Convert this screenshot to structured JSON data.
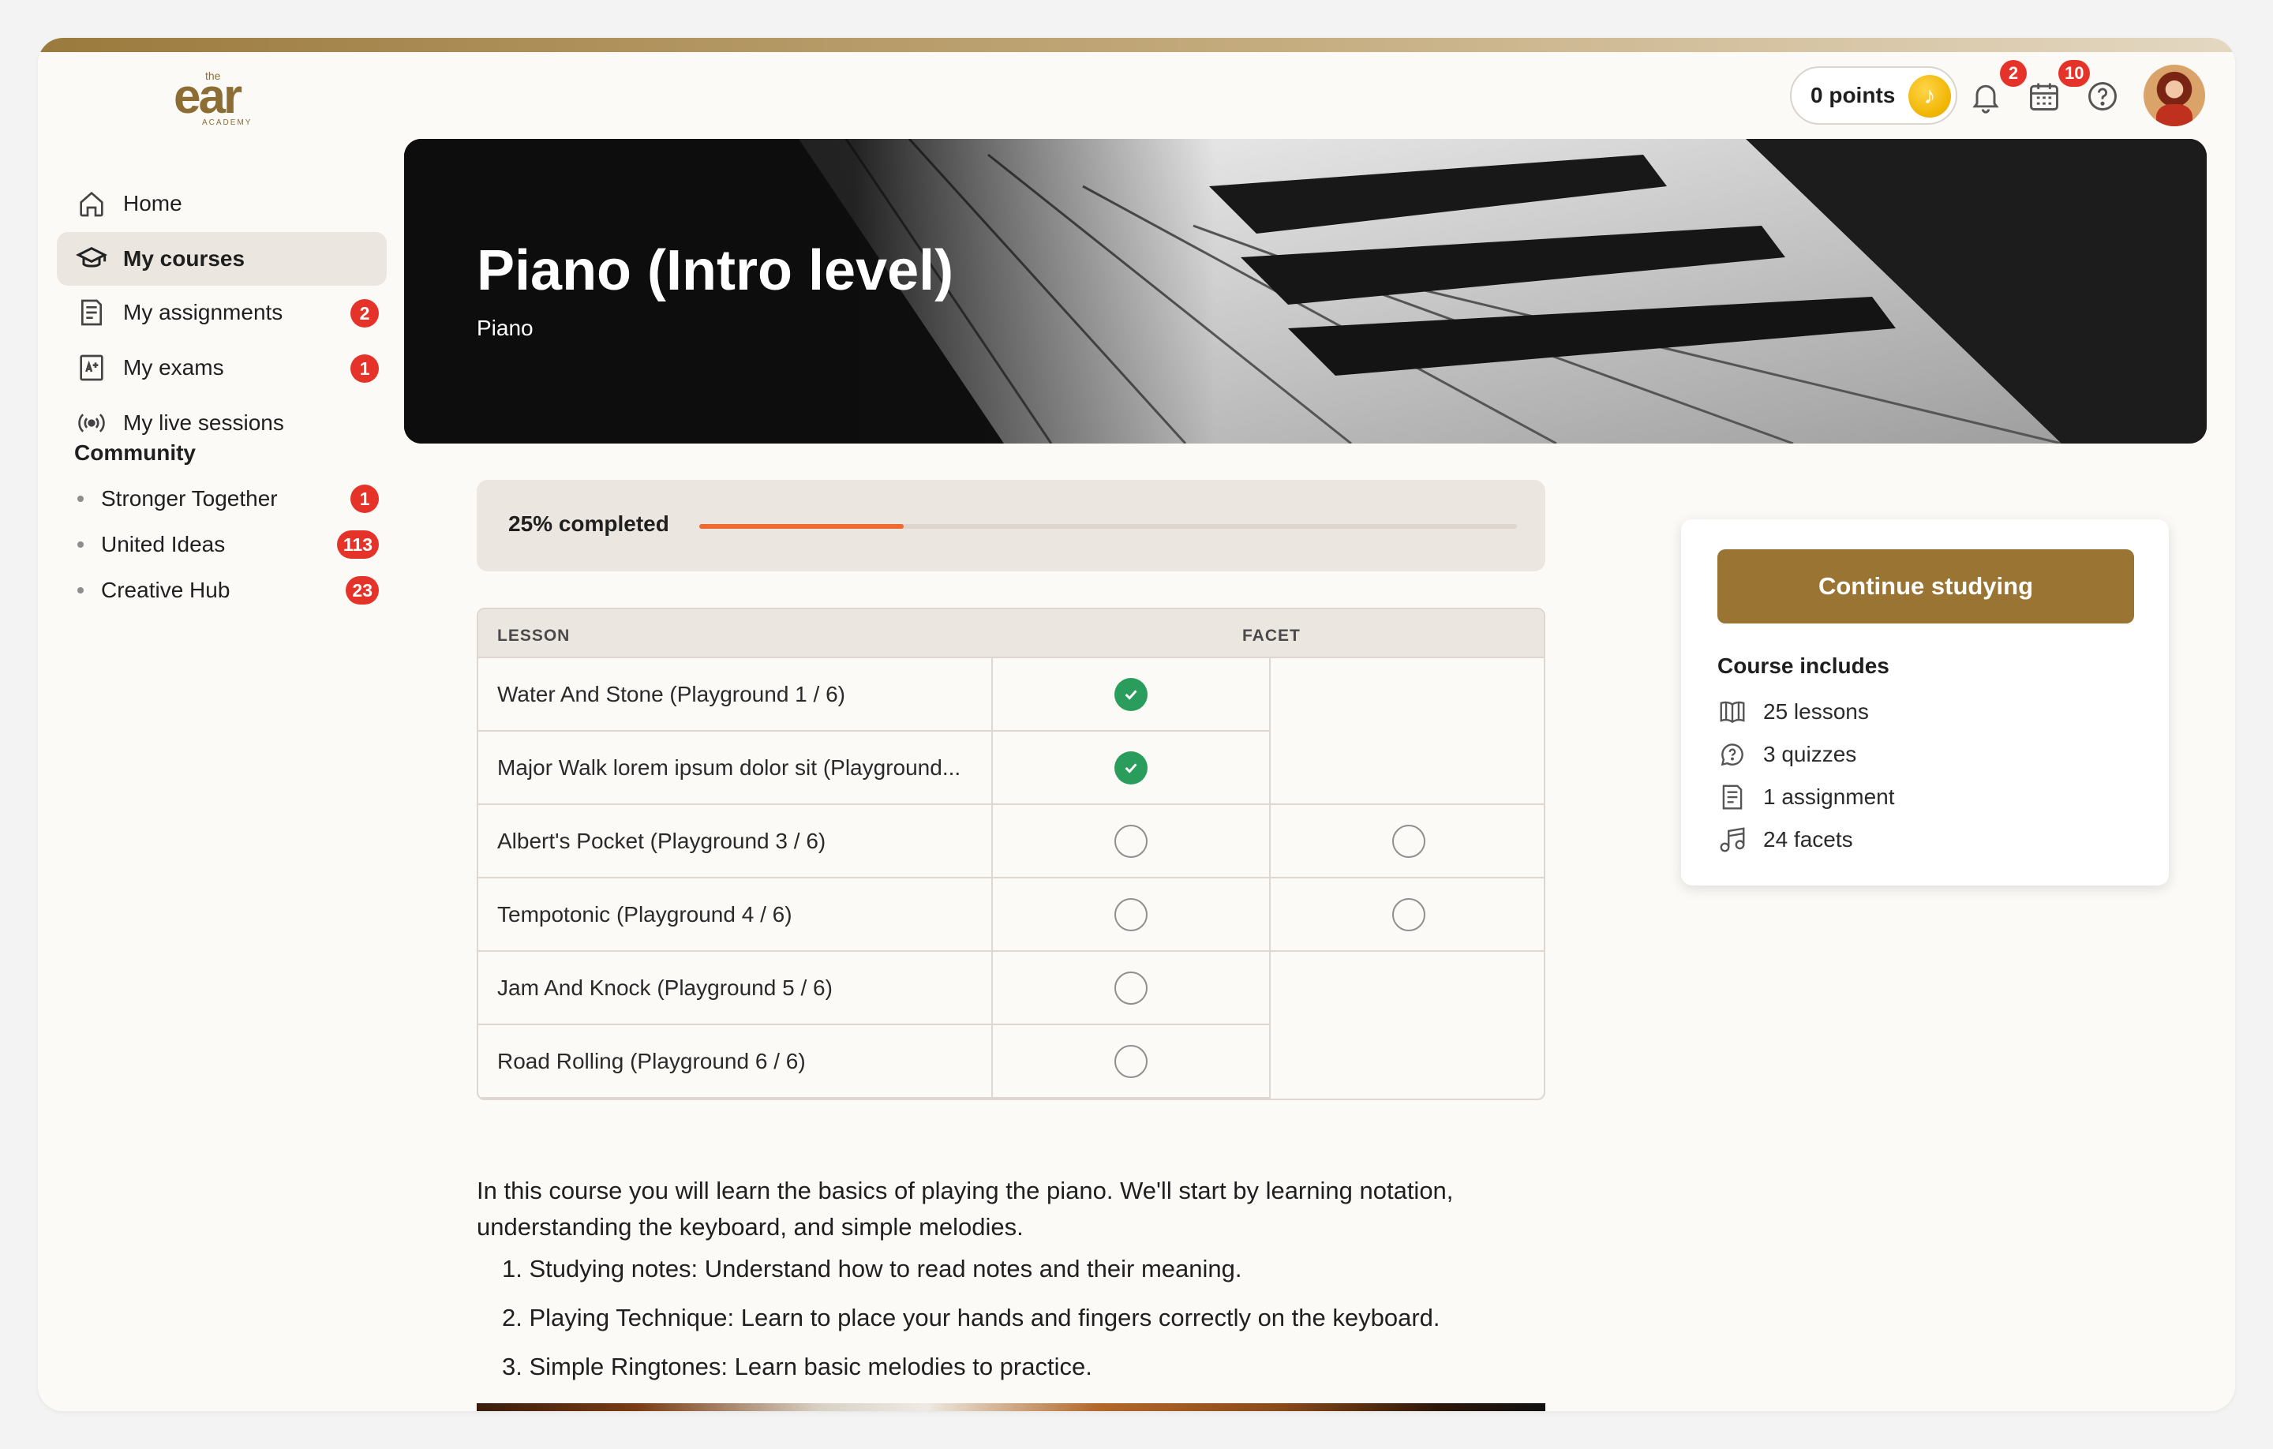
{
  "brand": {
    "logo_top": "the",
    "logo_main": "ear",
    "logo_sub": "ACADEMY"
  },
  "header": {
    "points_label": "0 points",
    "notifications_count": "2",
    "calendar_count": "10"
  },
  "sidebar": {
    "items": [
      {
        "label": "Home",
        "icon": "home-icon"
      },
      {
        "label": "My courses",
        "icon": "graduation-cap-icon",
        "active": true
      },
      {
        "label": "My assignments",
        "icon": "assignment-icon",
        "badge": "2"
      },
      {
        "label": "My exams",
        "icon": "exam-icon",
        "badge": "1"
      },
      {
        "label": "My live sessions",
        "icon": "broadcast-icon"
      }
    ],
    "community_title": "Community",
    "community": [
      {
        "label": "Stronger Together",
        "badge": "1"
      },
      {
        "label": "United Ideas",
        "badge": "113"
      },
      {
        "label": "Creative Hub",
        "badge": "23"
      }
    ]
  },
  "course": {
    "title": "Piano (Intro level)",
    "subtitle": "Piano",
    "progress_label": "25% completed",
    "progress_fraction": 0.25
  },
  "table": {
    "headers": [
      "LESSON",
      "FACET"
    ],
    "rows": [
      {
        "lesson": "Water And Stone (Playground 1 / 6)",
        "done": true
      },
      {
        "lesson": "Major Walk lorem ipsum dolor sit (Playground...",
        "done": true
      },
      {
        "lesson": "Albert's Pocket (Playground 3 / 6)",
        "done": false
      },
      {
        "lesson": "Tempotonic (Playground 4 / 6)",
        "done": false
      },
      {
        "lesson": "Jam And Knock (Playground 5 / 6)",
        "done": false
      },
      {
        "lesson": "Road Rolling (Playground 6 / 6)",
        "done": false
      }
    ]
  },
  "description": {
    "intro": "In this course you will learn the basics of playing the piano. We'll start by learning notation, understanding the keyboard, and simple melodies.",
    "steps": [
      "1. Studying notes: Understand how to read notes and their meaning.",
      "2. Playing Technique: Learn to place your hands and fingers correctly on the keyboard.",
      "3. Simple Ringtones: Learn basic melodies to practice."
    ]
  },
  "course_card": {
    "button_label": "Continue studying",
    "includes_title": "Course includes",
    "includes": [
      {
        "label": "25 lessons",
        "icon": "book-icon"
      },
      {
        "label": "3 quizzes",
        "icon": "quiz-icon"
      },
      {
        "label": "1 assignment",
        "icon": "assignment-icon"
      },
      {
        "label": "24 facets",
        "icon": "music-note-icon"
      }
    ]
  },
  "colors": {
    "accent": "#9a7433",
    "progress": "#ee6a32",
    "badge": "#e5332a",
    "check": "#2a9d5c"
  }
}
